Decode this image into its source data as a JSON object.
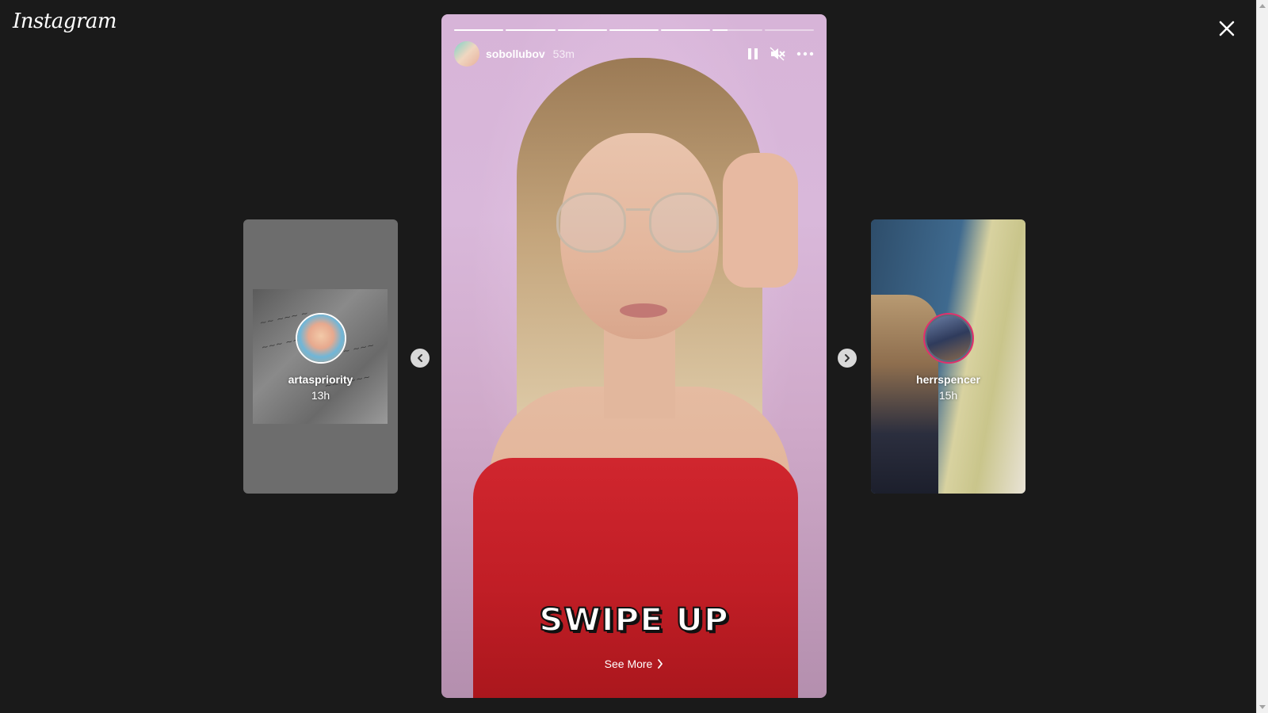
{
  "brand": {
    "logo_text": "Instagram"
  },
  "icons": {
    "close": "close-icon",
    "pause": "pause-icon",
    "mute": "muted-speaker-icon",
    "more": "more-options-icon",
    "prev": "chevron-left-icon",
    "next": "chevron-right-icon",
    "see_more": "chevron-right-icon"
  },
  "colors": {
    "background": "#1a1a1a",
    "story_ring": "#e1306c",
    "dress": "#c11e26",
    "wall": "#d7b4d8"
  },
  "story": {
    "username": "sobollubov",
    "time_ago": "53m",
    "sticker_text": "SWIPE UP",
    "see_more_label": "See More",
    "progress": [
      1,
      1,
      1,
      1,
      1,
      0.3,
      0
    ]
  },
  "prev_story": {
    "username": "artaspriority",
    "time_ago": "13h"
  },
  "next_story": {
    "username": "herrspencer",
    "time_ago": "15h"
  }
}
